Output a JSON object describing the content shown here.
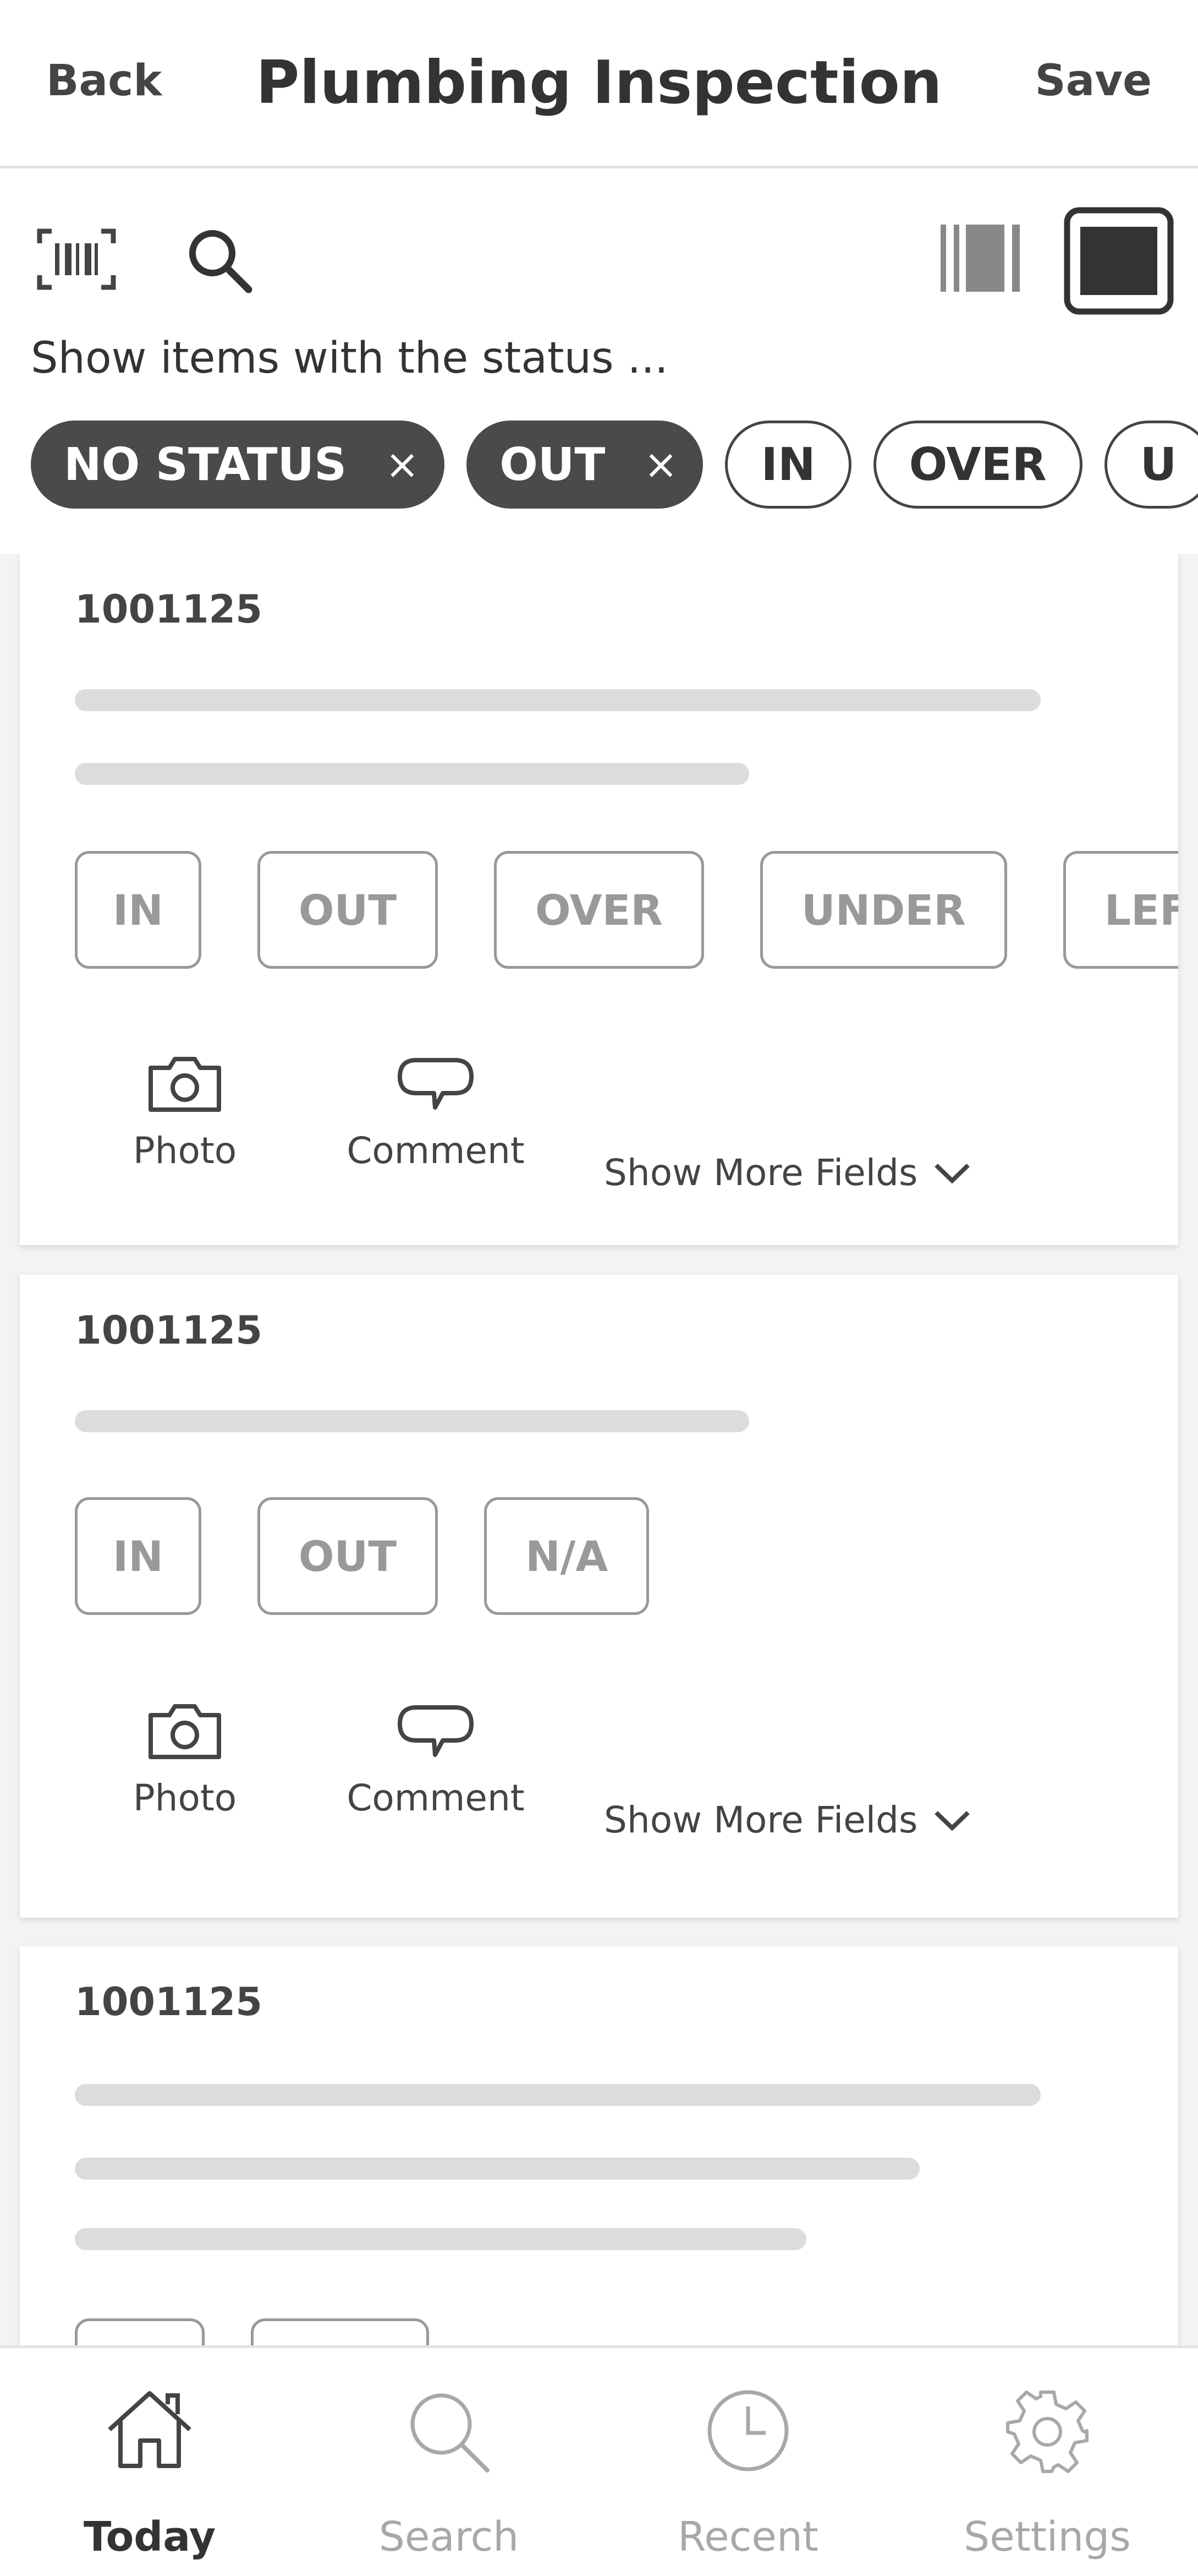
{
  "header": {
    "back_label": "Back",
    "title": "Plumbing Inspection",
    "save_label": "Save"
  },
  "toolbar": {
    "scan_icon": "barcode-scan-icon",
    "search_icon": "search-icon",
    "view_compact_icon": "compact-view-icon",
    "view_card_icon": "card-view-icon",
    "status_caption": "Show items with the status ...",
    "chips": [
      {
        "label": "NO STATUS",
        "selected": true
      },
      {
        "label": "OUT",
        "selected": true
      },
      {
        "label": "IN",
        "selected": false
      },
      {
        "label": "OVER",
        "selected": false
      },
      {
        "label": "U",
        "selected": false
      }
    ],
    "chip_remove_glyph": "×"
  },
  "cards": [
    {
      "id": "1001125",
      "choices": [
        "IN",
        "OUT",
        "OVER",
        "UNDER",
        "LEF"
      ],
      "photo_label": "Photo",
      "comment_label": "Comment",
      "more_label": "Show More Fields"
    },
    {
      "id": "1001125",
      "choices": [
        "IN",
        "OUT",
        "N/A"
      ],
      "photo_label": "Photo",
      "comment_label": "Comment",
      "more_label": "Show More Fields"
    },
    {
      "id": "1001125"
    }
  ],
  "bottom_nav": [
    {
      "label": "Today",
      "icon": "home-icon",
      "active": true
    },
    {
      "label": "Search",
      "icon": "search-icon",
      "active": false
    },
    {
      "label": "Recent",
      "icon": "clock-icon",
      "active": false
    },
    {
      "label": "Settings",
      "icon": "gear-icon",
      "active": false
    }
  ],
  "colors": {
    "chip_selected_bg": "#4a4a4a",
    "placeholder_bar": "#dcdcdc",
    "choice_border": "#999999",
    "nav_inactive": "#a8a8a8"
  }
}
